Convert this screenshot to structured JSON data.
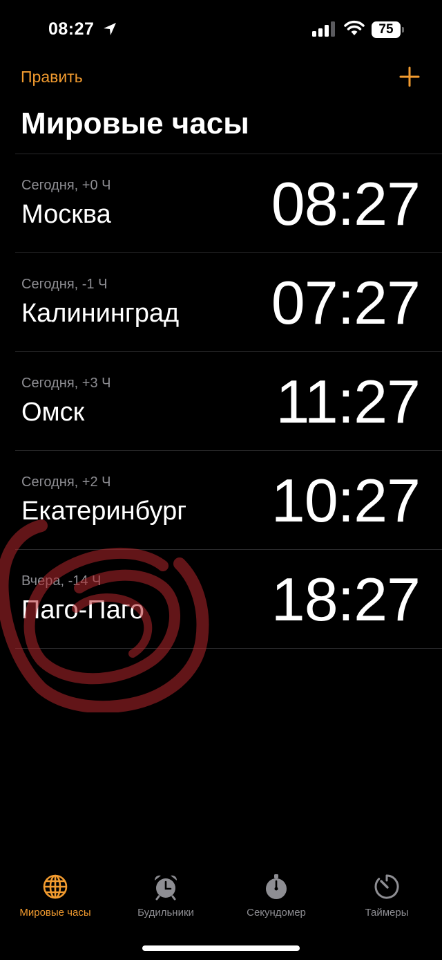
{
  "status_bar": {
    "time": "08:27",
    "battery": "75"
  },
  "header": {
    "edit_label": "Править",
    "title": "Мировые часы"
  },
  "clocks": [
    {
      "offset": "Сегодня, +0 Ч",
      "city": "Москва",
      "time": "08:27"
    },
    {
      "offset": "Сегодня, -1 Ч",
      "city": "Калининград",
      "time": "07:27"
    },
    {
      "offset": "Сегодня, +3 Ч",
      "city": "Омск",
      "time": "11:27"
    },
    {
      "offset": "Сегодня, +2 Ч",
      "city": "Екатеринбург",
      "time": "10:27"
    },
    {
      "offset": "Вчера, -14 Ч",
      "city": "Паго-Паго",
      "time": "18:27"
    }
  ],
  "tabs": [
    {
      "label": "Мировые часы",
      "icon": "globe-icon",
      "active": true
    },
    {
      "label": "Будильники",
      "icon": "alarm-clock-icon",
      "active": false
    },
    {
      "label": "Секундомер",
      "icon": "stopwatch-icon",
      "active": false
    },
    {
      "label": "Таймеры",
      "icon": "timer-icon",
      "active": false
    }
  ],
  "colors": {
    "accent": "#f29b2f",
    "background": "#000000",
    "secondary_text": "#8e8e93",
    "annotation": "#b3262b"
  }
}
